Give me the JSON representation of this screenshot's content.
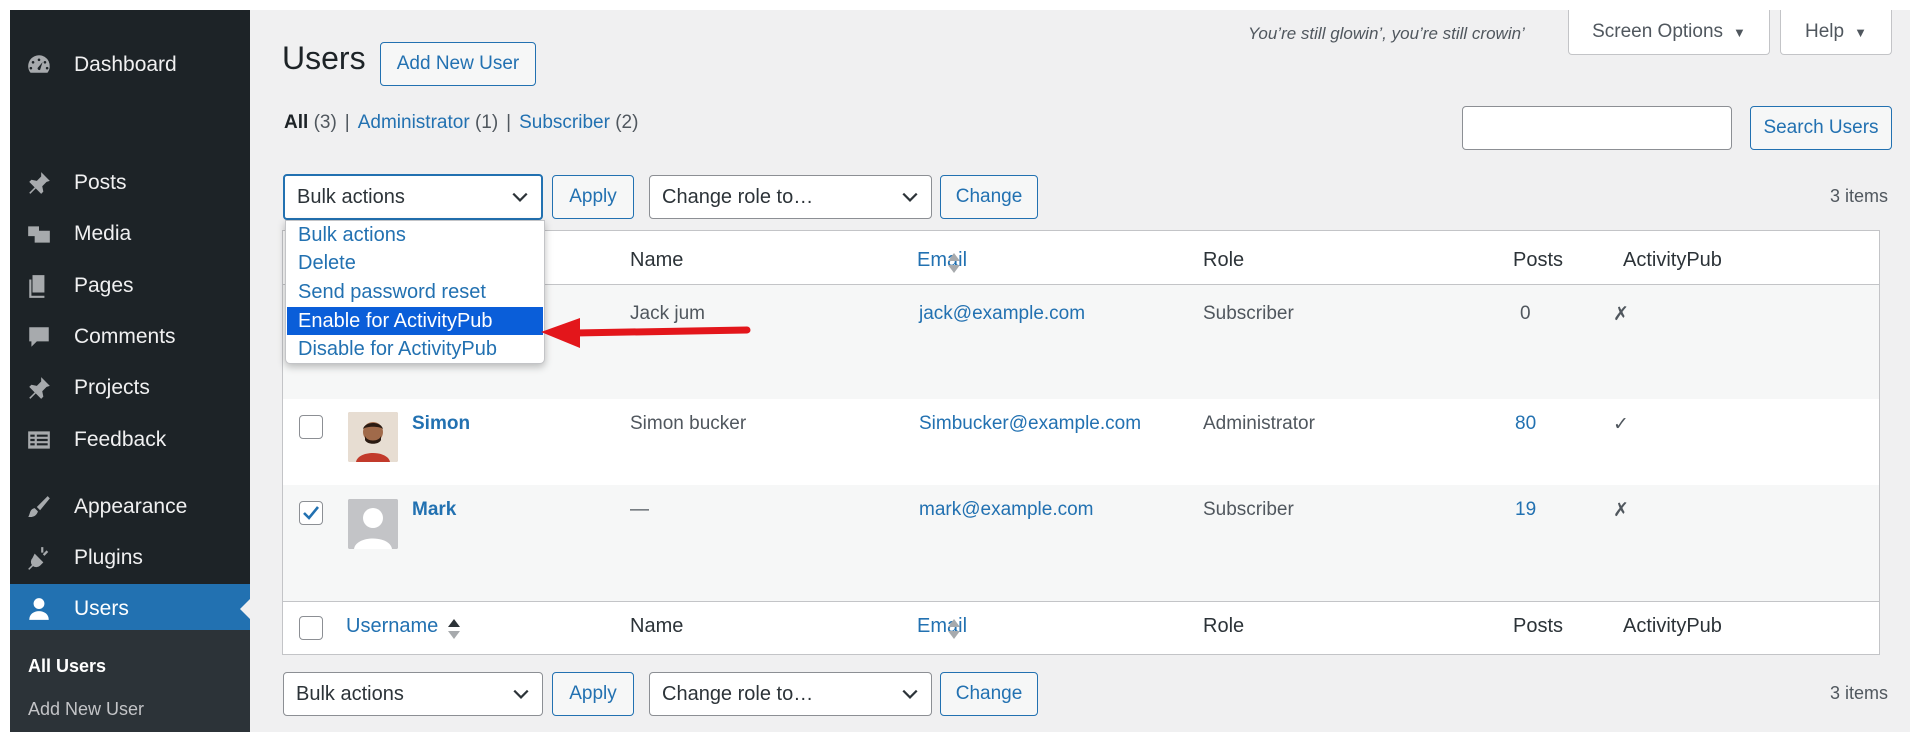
{
  "sidebar": {
    "items": [
      {
        "label": "Dashboard",
        "icon": "dashboard-icon"
      },
      {
        "label": "Posts",
        "icon": "pin-icon"
      },
      {
        "label": "Media",
        "icon": "media-icon"
      },
      {
        "label": "Pages",
        "icon": "pages-icon"
      },
      {
        "label": "Comments",
        "icon": "comment-icon"
      },
      {
        "label": "Projects",
        "icon": "pin-icon"
      },
      {
        "label": "Feedback",
        "icon": "feedback-icon"
      },
      {
        "label": "Appearance",
        "icon": "brush-icon"
      },
      {
        "label": "Plugins",
        "icon": "plug-icon"
      },
      {
        "label": "Users",
        "icon": "user-icon"
      }
    ],
    "submenu": [
      "All Users",
      "Add New User"
    ]
  },
  "header": {
    "tagline": "You’re still glowin’, you’re still crowin’",
    "screen_options": "Screen Options",
    "help": "Help",
    "dropdown_glyph": "▼"
  },
  "page": {
    "title": "Users",
    "add_new": "Add New User"
  },
  "filters": [
    {
      "label": "All",
      "count": "(3)"
    },
    {
      "label": "Administrator",
      "count": "(1)"
    },
    {
      "label": "Subscriber",
      "count": "(2)"
    }
  ],
  "filter_sep": "|",
  "search": {
    "button": "Search Users",
    "value": ""
  },
  "tablenav": {
    "bulk": "Bulk actions",
    "apply": "Apply",
    "role": "Change role to…",
    "change": "Change",
    "count": "3 items"
  },
  "bulk_dropdown": {
    "options": [
      "Bulk actions",
      "Delete",
      "Send password reset",
      "Enable for ActivityPub",
      "Disable for ActivityPub"
    ],
    "highlighted_index": 3
  },
  "columns": {
    "username": "Username",
    "name": "Name",
    "email": "Email",
    "role": "Role",
    "posts": "Posts",
    "activitypub": "ActivityPub"
  },
  "rows": [
    {
      "username": "",
      "name": "Jack jum",
      "email": "jack@example.com",
      "role": "Subscriber",
      "posts": "0",
      "activitypub": "✗",
      "checked": false
    },
    {
      "username": "Simon",
      "name": "Simon bucker",
      "email": "Simbucker@example.com",
      "role": "Administrator",
      "posts": "80",
      "activitypub": "✓",
      "checked": false
    },
    {
      "username": "Mark",
      "name": "—",
      "email": "mark@example.com",
      "role": "Subscriber",
      "posts": "19",
      "activitypub": "✗",
      "checked": true
    }
  ],
  "colors": {
    "accent": "#2271b1",
    "sidebar": "#1d2327",
    "highlight": "#0a5ed9",
    "arrow": "#e3161b"
  }
}
